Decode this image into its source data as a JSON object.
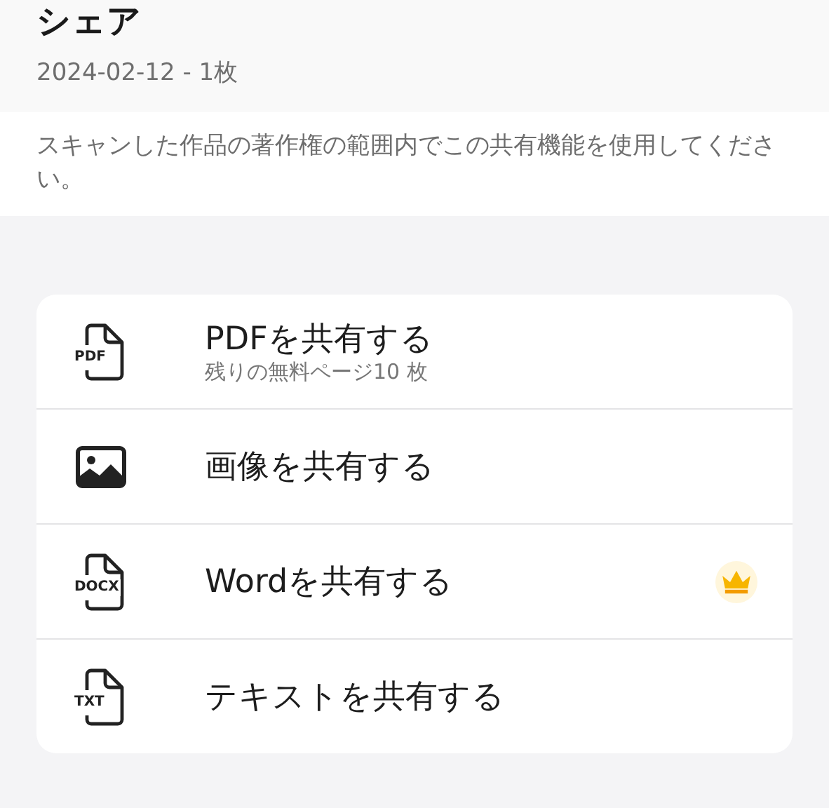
{
  "header": {
    "title": "シェア",
    "subtitle": "2024-02-12 - 1枚"
  },
  "notice": "スキャンした作品の著作権の範囲内でこの共有機能を使用してください。",
  "options": [
    {
      "kind": "file",
      "icon_label": "PDF",
      "label": "PDFを共有する",
      "detail": "残りの無料ページ10 枚",
      "premium": false
    },
    {
      "kind": "image",
      "label": "画像を共有する",
      "premium": false
    },
    {
      "kind": "file",
      "icon_label": "DOCX",
      "label": "Wordを共有する",
      "premium": true
    },
    {
      "kind": "file",
      "icon_label": "TXT",
      "label": "テキストを共有する",
      "premium": false
    }
  ]
}
